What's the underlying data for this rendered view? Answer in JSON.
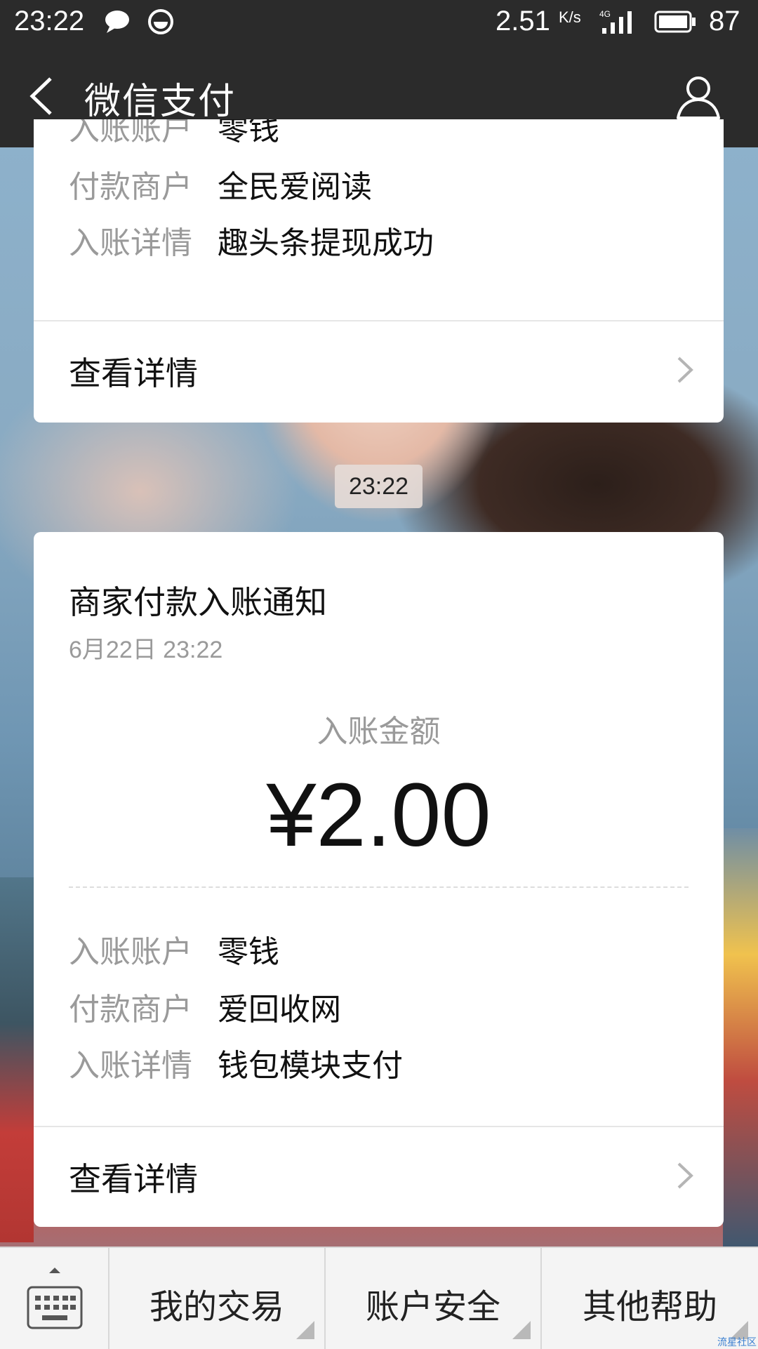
{
  "status_bar": {
    "time": "23:22",
    "net_speed": "2.51",
    "net_speed_unit": "K/s",
    "network_type": "4G",
    "battery": "87",
    "icons": [
      "chat-bubble-icon",
      "app-circle-icon",
      "signal-icon",
      "battery-icon"
    ]
  },
  "title_bar": {
    "title": "微信支付",
    "back_icon": "chevron-left-icon",
    "profile_icon": "user-icon"
  },
  "previous_message": {
    "rows": [
      {
        "label": "入账账户",
        "value": "零钱"
      },
      {
        "label": "付款商户",
        "value": "全民爱阅读"
      },
      {
        "label": "入账详情",
        "value": "趣头条提现成功"
      }
    ],
    "detail_link": "查看详情"
  },
  "timestamp_chip": "23:22",
  "current_message": {
    "title": "商家付款入账通知",
    "date": "6月22日  23:22",
    "amount_label": "入账金额",
    "amount": "¥2.00",
    "rows": [
      {
        "label": "入账账户",
        "value": "零钱"
      },
      {
        "label": "付款商户",
        "value": "爱回收网"
      },
      {
        "label": "入账详情",
        "value": "钱包模块支付"
      }
    ],
    "detail_link": "查看详情"
  },
  "bottom_menu": {
    "keyboard_icon": "keyboard-icon",
    "tabs": [
      "我的交易",
      "账户安全",
      "其他帮助"
    ]
  },
  "watermark": "流星社区"
}
